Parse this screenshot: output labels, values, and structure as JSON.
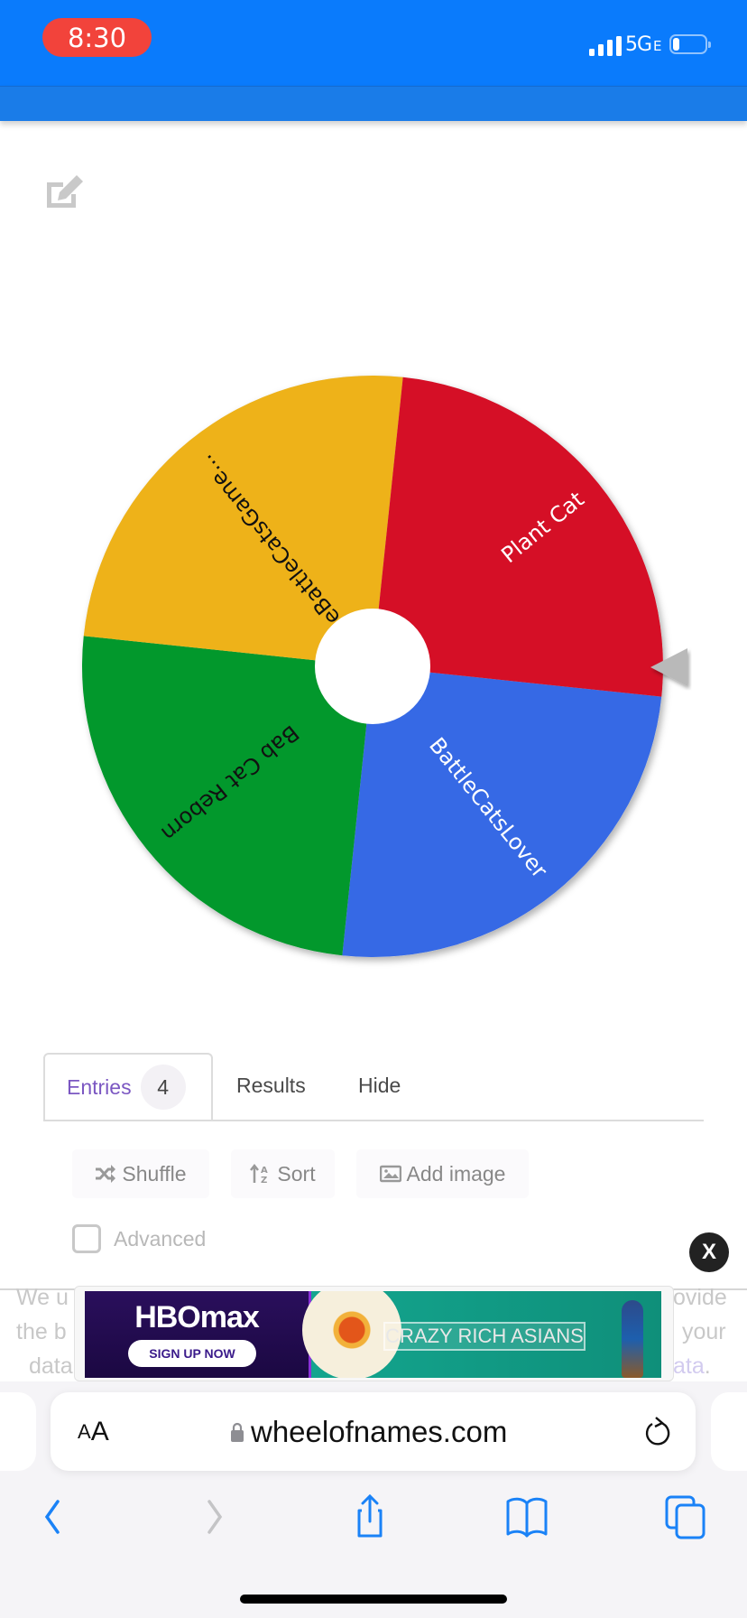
{
  "status_bar": {
    "time": "8:30",
    "network": "5G",
    "network_suffix": "E",
    "battery_level": 0.2,
    "time_pill_color": "#f2433b",
    "bar_color": "#0a7bfc"
  },
  "app": {
    "title": "wheelofnames.com",
    "header_color": "#1a7ce8",
    "edit_icon": "edit-icon"
  },
  "wheel": {
    "rotation_deg": 6,
    "pointer_icon": "triangle-pointer",
    "slices": [
      {
        "label": "BattleCatsLover",
        "color": "#3669e5",
        "text_color": "#ffffff"
      },
      {
        "label": "Bab Cat Reborn",
        "color": "#02982c",
        "text_color": "#111111"
      },
      {
        "label": "TheBattleCatsGame...",
        "color": "#eeb219",
        "text_color": "#111111"
      },
      {
        "label": "Plant Cat",
        "color": "#d50f26",
        "text_color": "#ffffff"
      }
    ]
  },
  "tabs": {
    "entries_label": "Entries",
    "entries_count": "4",
    "results_label": "Results",
    "hide_label": "Hide",
    "active": "Entries",
    "active_color": "#7b57c2"
  },
  "toolbar": {
    "shuffle_label": "Shuffle",
    "sort_label": "Sort",
    "add_image_label": "Add image",
    "advanced_label": "Advanced",
    "advanced_checked": false
  },
  "consent": {
    "line1_left": "We u",
    "line1_right": "ovide",
    "line2_left": "the b",
    "line2_right": "your",
    "line3_left": "data",
    "line3_right_link": "ata",
    "line3_right_end": "."
  },
  "ad": {
    "close_label": "X",
    "brand": "HBOmax",
    "cta": "SIGN UP NOW",
    "title": "CRAZY RICH ASIANS"
  },
  "browser": {
    "text_size_label_small": "A",
    "text_size_label_large": "A",
    "url": "wheelofnames.com",
    "accent_color": "#1a82f7",
    "toolbar_icons": [
      "back-icon",
      "forward-icon",
      "share-icon",
      "bookmarks-icon",
      "tabs-icon"
    ]
  }
}
